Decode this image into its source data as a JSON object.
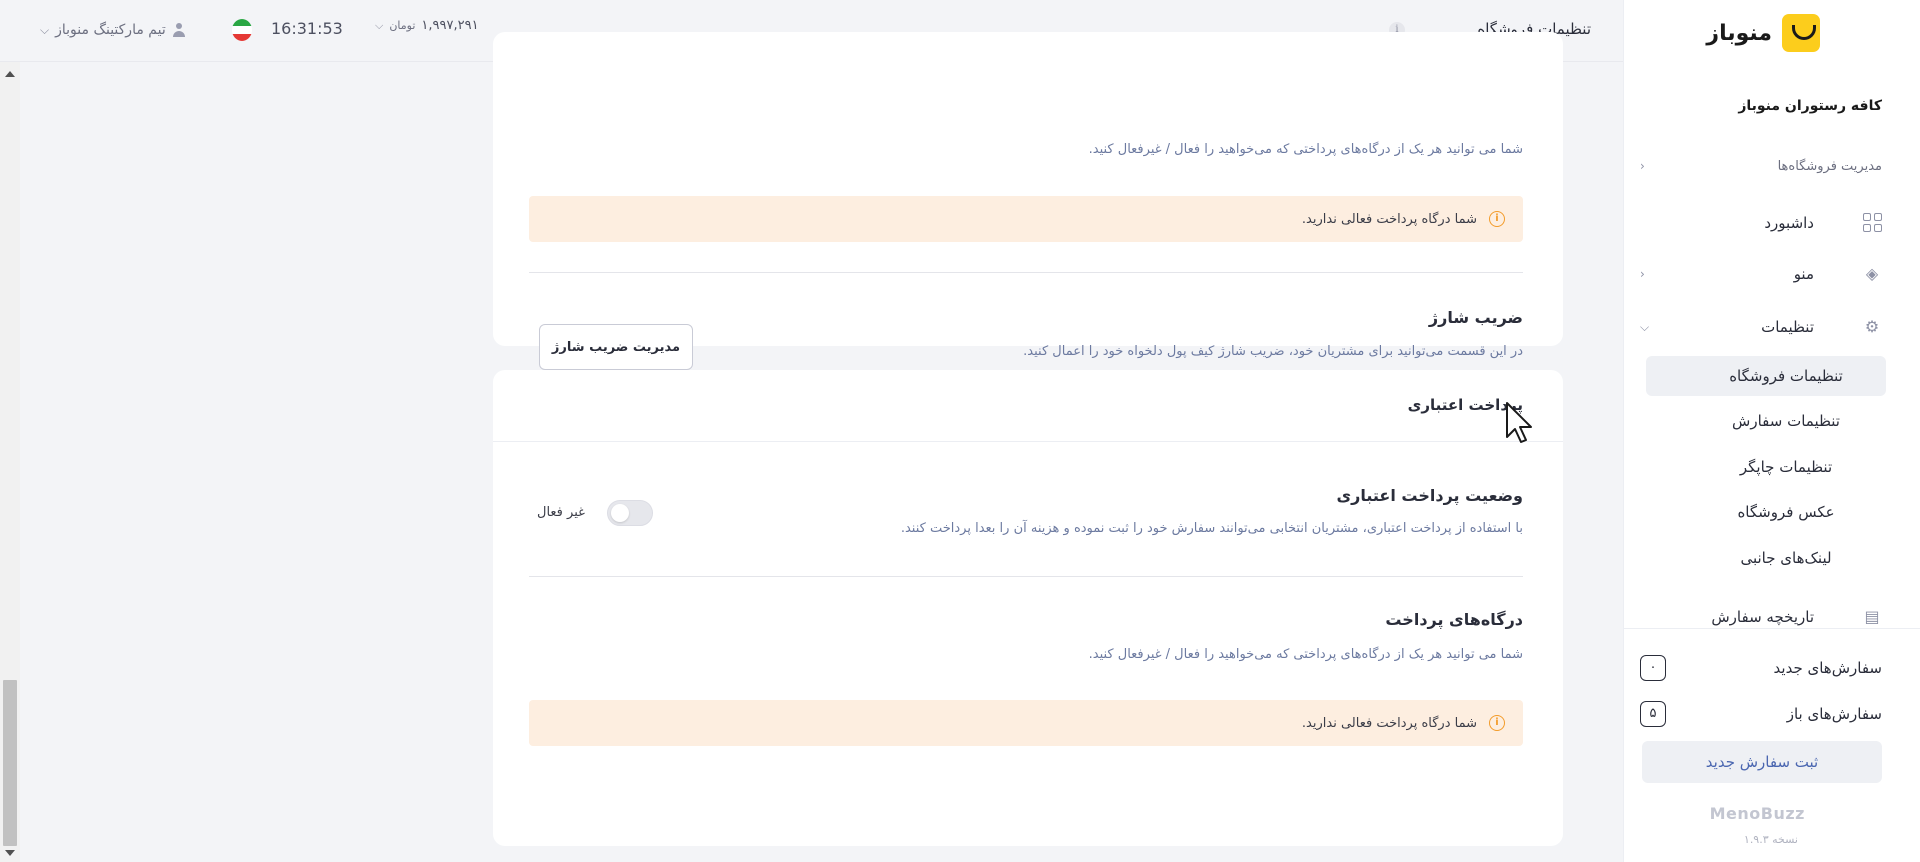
{
  "header": {
    "page_title": "تنظیمات فروشگاه",
    "info_glyph": "i",
    "balance_value": "۱,۹۹۷,۲۹۱",
    "balance_currency": "تومان",
    "time": "16:31:53",
    "user_name": "تیم مارکتینگ منوباز"
  },
  "gateways_top": {
    "description": "شما می توانید هر یک از درگاه‌های پرداختی که می‌خواهید را فعال / غیرفعال کنید.",
    "alert_text": "شما درگاه پرداخت فعالی ندارید."
  },
  "charge_coefficient": {
    "title": "ضریب شارژ",
    "description": "در این قسمت می‌توانید برای مشتریان خود، ضریب شارژ کیف پول دلخواه خود را اعمال کنید.",
    "button_label": "مدیریت ضریب شارژ"
  },
  "credit_payment": {
    "header_title": "پرداخت اعتباری",
    "status_title": "وضعیت پرداخت اعتباری",
    "status_description": "با استفاده از پرداخت اعتباری، مشتریان انتخابی می‌توانند سفارش خود را ثبت نموده و هزینه آن را بعدا پرداخت کنند.",
    "toggle_state": "غیر فعال",
    "toggle_on": false,
    "gateways_title": "درگاه‌های پرداخت",
    "gateways_description": "شما می توانید هر یک از درگاه‌های پرداختی که می‌خواهید را فعال / غیرفعال کنید.",
    "alert_text": "شما درگاه پرداخت فعالی ندارید."
  },
  "sidebar": {
    "brand_name": "منوباز",
    "shop_name": "کافه رستوران منوباز",
    "store_management": "مدیریت فروشگاه‌ها",
    "nav": [
      {
        "label": "داشبورد",
        "icon": "dashboard-icon"
      },
      {
        "label": "منو",
        "icon": "layers-icon"
      },
      {
        "label": "تنظیمات",
        "icon": "gear-icon"
      },
      {
        "label": "تاریخچه سفارش",
        "icon": "receipt-icon"
      }
    ],
    "settings_sub": [
      {
        "label": "تنظیمات فروشگاه",
        "active": true
      },
      {
        "label": "تنظیمات سفارش"
      },
      {
        "label": "تنظیمات چاپگر"
      },
      {
        "label": "عکس فروشگاه"
      },
      {
        "label": "لینک‌های جانبی"
      }
    ],
    "new_orders_label": "سفارش‌های جدید",
    "new_orders_count": "۰",
    "open_orders_label": "سفارش‌های باز",
    "open_orders_count": "۵",
    "new_order_button": "ثبت سفارش جدید",
    "footer_brand": "MenoBuzz",
    "version": "نسخه ۱.۹.۳"
  },
  "colors": {
    "accent_yellow": "#fccd1c",
    "alert_bg": "#fdeee0",
    "warn_orange": "#f39c2b",
    "link_blue": "#4a66b0"
  }
}
